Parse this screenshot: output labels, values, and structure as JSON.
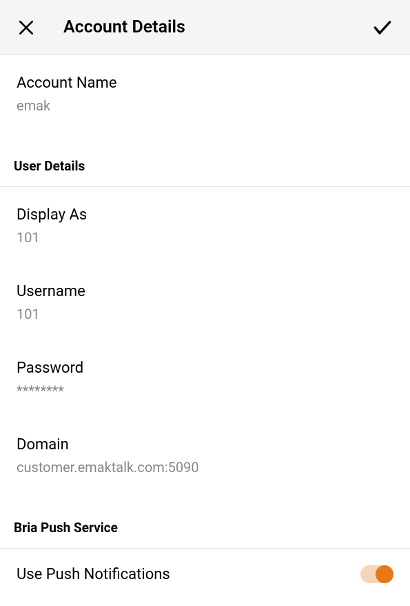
{
  "header": {
    "title": "Account Details"
  },
  "account": {
    "name_label": "Account Name",
    "name_value": "emak"
  },
  "sections": {
    "user_details": "User Details",
    "bria_push": "Bria Push Service"
  },
  "fields": {
    "display_as_label": "Display As",
    "display_as_value": "101",
    "username_label": "Username",
    "username_value": "101",
    "password_label": "Password",
    "password_value": "********",
    "domain_label": "Domain",
    "domain_value": "customer.emaktalk.com:5090"
  },
  "push": {
    "label": "Use Push Notifications",
    "enabled": true
  }
}
